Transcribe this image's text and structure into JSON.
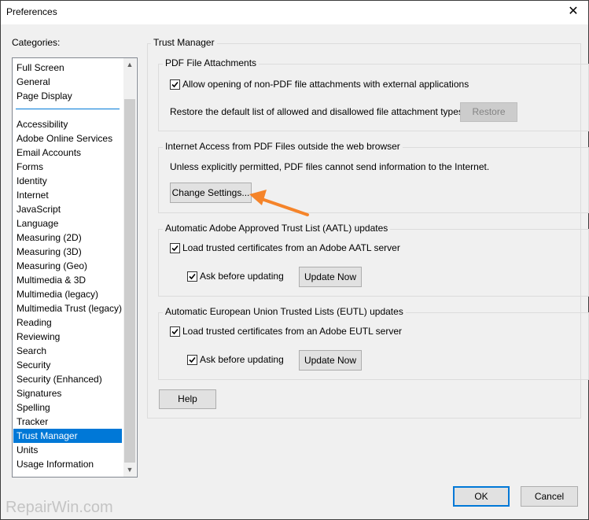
{
  "window": {
    "title": "Preferences",
    "close_glyph": "✕"
  },
  "categories": {
    "label": "Categories:",
    "top_items": [
      "Full Screen",
      "General",
      "Page Display"
    ],
    "items": [
      "Accessibility",
      "Adobe Online Services",
      "Email Accounts",
      "Forms",
      "Identity",
      "Internet",
      "JavaScript",
      "Language",
      "Measuring (2D)",
      "Measuring (3D)",
      "Measuring (Geo)",
      "Multimedia & 3D",
      "Multimedia (legacy)",
      "Multimedia Trust (legacy)",
      "Reading",
      "Reviewing",
      "Search",
      "Security",
      "Security (Enhanced)",
      "Signatures",
      "Spelling",
      "Tracker",
      "Trust Manager",
      "Units",
      "Usage Information"
    ],
    "selected": "Trust Manager"
  },
  "panel": {
    "title": "Trust Manager",
    "pdf_attachments": {
      "title": "PDF File Attachments",
      "allow_label": "Allow opening of non-PDF file attachments with external applications",
      "allow_checked": true,
      "restore_text": "Restore the default list of allowed and disallowed file attachment types:",
      "restore_button": "Restore"
    },
    "internet_access": {
      "title": "Internet Access from PDF Files outside the web browser",
      "description": "Unless explicitly permitted, PDF files cannot send information to the Internet.",
      "change_button": "Change Settings..."
    },
    "aatl": {
      "title": "Automatic Adobe Approved Trust List (AATL) updates",
      "load_label": "Load trusted certificates from an Adobe AATL server",
      "load_checked": true,
      "ask_label": "Ask before updating",
      "ask_checked": true,
      "update_button": "Update Now"
    },
    "eutl": {
      "title": "Automatic European Union Trusted Lists (EUTL) updates",
      "load_label": "Load trusted certificates from an Adobe EUTL server",
      "load_checked": true,
      "ask_label": "Ask before updating",
      "ask_checked": true,
      "update_button": "Update Now"
    }
  },
  "buttons": {
    "help": "Help",
    "ok": "OK",
    "cancel": "Cancel"
  },
  "watermark": "RepairWin.com",
  "colors": {
    "selection": "#0078d7",
    "arrow": "#f5842a"
  }
}
